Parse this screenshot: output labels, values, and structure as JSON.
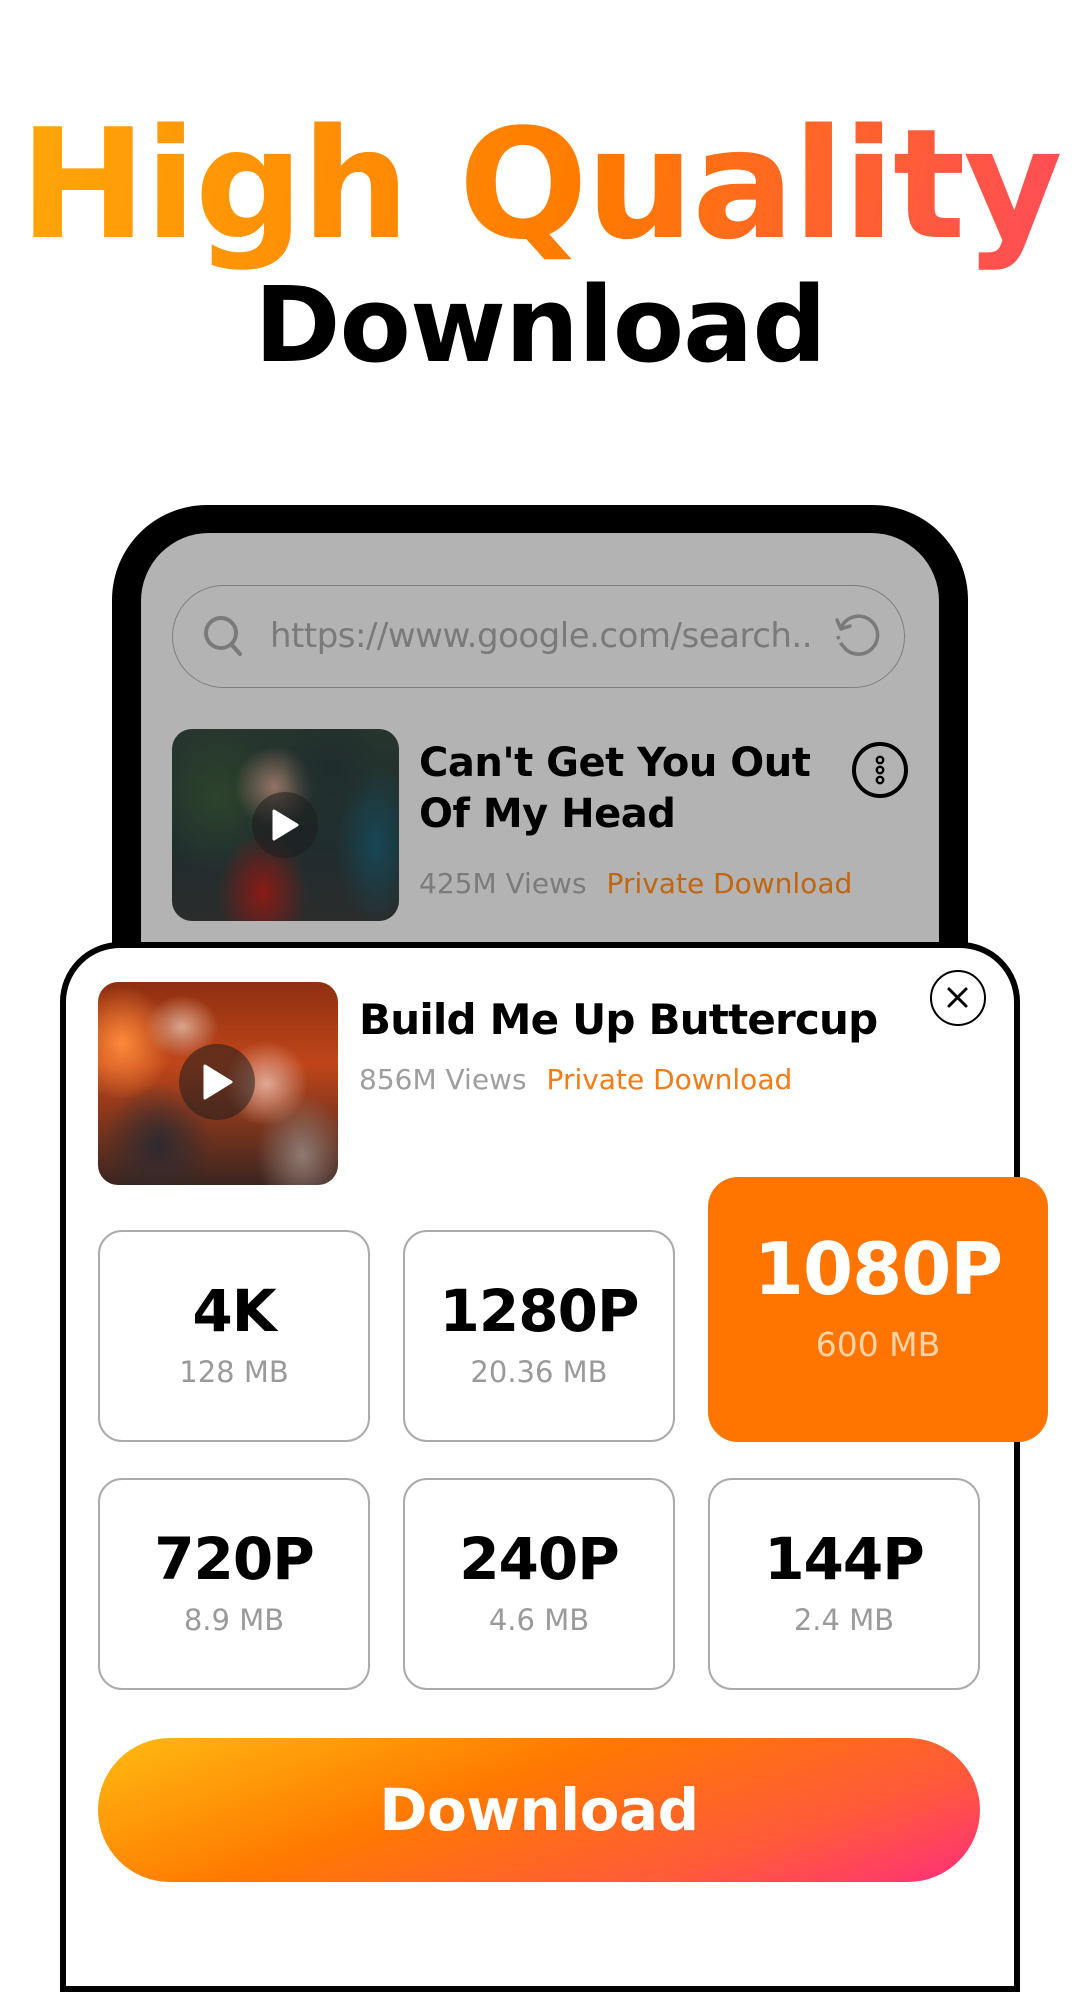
{
  "promo": {
    "headline": "High Quality",
    "subheadline": "Download",
    "accent_gradient": [
      "#ffa80a",
      "#ff7a00",
      "#ff4a5c"
    ]
  },
  "browser": {
    "search_placeholder": "https://www.google.com/search..",
    "search_icon": "search-icon",
    "refresh_icon": "refresh-icon"
  },
  "video_list": [
    {
      "title": "Can't Get You Out Of My Head",
      "views": "425M Views",
      "action": "Private Download",
      "menu_icon": "more-vertical-icon"
    }
  ],
  "download_sheet": {
    "title": "Build Me Up Buttercup",
    "views": "856M Views",
    "action": "Private Download",
    "close_icon": "close-icon",
    "qualities": [
      {
        "label": "4K",
        "size": "128 MB",
        "selected": false
      },
      {
        "label": "1280P",
        "size": "20.36 MB",
        "selected": false
      },
      {
        "label": "1080P",
        "size": "600 MB",
        "selected": true
      },
      {
        "label": "720P",
        "size": "8.9 MB",
        "selected": false
      },
      {
        "label": "240P",
        "size": "4.6 MB",
        "selected": false
      },
      {
        "label": "144P",
        "size": "2.4 MB",
        "selected": false
      }
    ],
    "download_label": "Download",
    "selected_color": "#ff7500"
  }
}
